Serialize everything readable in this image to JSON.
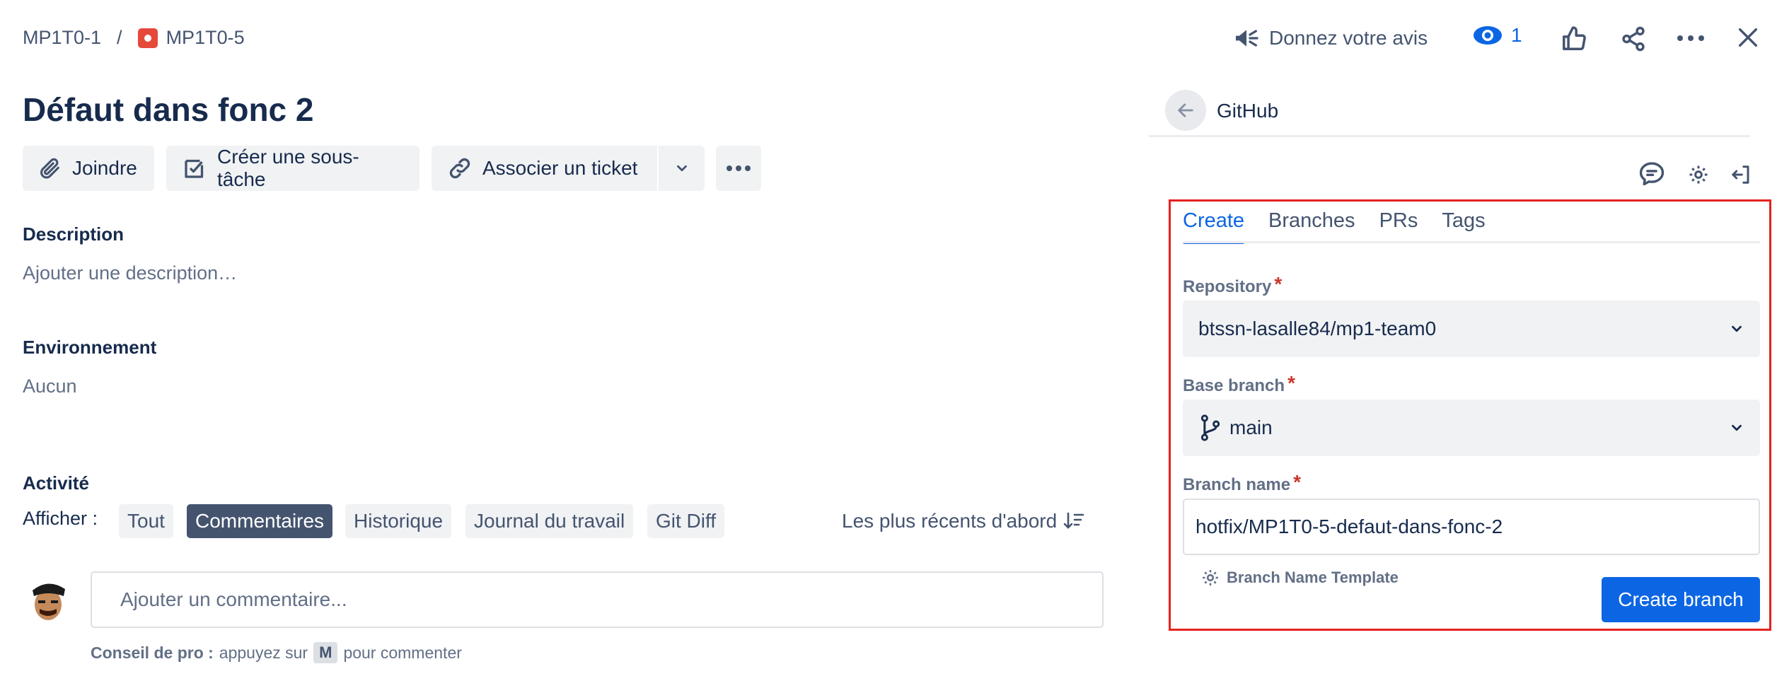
{
  "breadcrumb": {
    "parent": "MP1T0-1",
    "separator": "/",
    "current": "MP1T0-5"
  },
  "issue": {
    "title": "Défaut dans fonc 2"
  },
  "toolbar": {
    "attach_label": "Joindre",
    "subtask_label": "Créer une sous-tâche",
    "link_label": "Associer un ticket"
  },
  "description": {
    "label": "Description",
    "placeholder": "Ajouter une description…"
  },
  "environment": {
    "label": "Environnement",
    "value": "Aucun"
  },
  "activity": {
    "label": "Activité",
    "show_label": "Afficher :",
    "filters": [
      "Tout",
      "Commentaires",
      "Historique",
      "Journal du travail",
      "Git Diff"
    ],
    "active_filter": "Commentaires",
    "sort_label": "Les plus récents d'abord",
    "comment_placeholder": "Ajouter un commentaire...",
    "tip_prefix": "Conseil de pro :",
    "tip_text": "appuyez sur",
    "tip_key": "M",
    "tip_suffix": "pour commenter"
  },
  "header_actions": {
    "feedback_label": "Donnez votre avis",
    "watchers_count": "1"
  },
  "github_panel": {
    "title": "GitHub",
    "tabs": [
      "Create",
      "Branches",
      "PRs",
      "Tags"
    ],
    "active_tab": "Create",
    "repository_label": "Repository",
    "repository_value": "btssn-lasalle84/mp1-team0",
    "base_branch_label": "Base branch",
    "base_branch_value": "main",
    "branch_name_label": "Branch name",
    "branch_name_value": "hotfix/MP1T0-5-defaut-dans-fonc-2",
    "template_label": "Branch Name Template",
    "create_button": "Create branch",
    "required_marker": "*"
  },
  "colors": {
    "primary": "#0c66e4",
    "highlight_border": "#e5221f",
    "bug_icon": "#e5493a",
    "active_chip": "#44546f"
  }
}
